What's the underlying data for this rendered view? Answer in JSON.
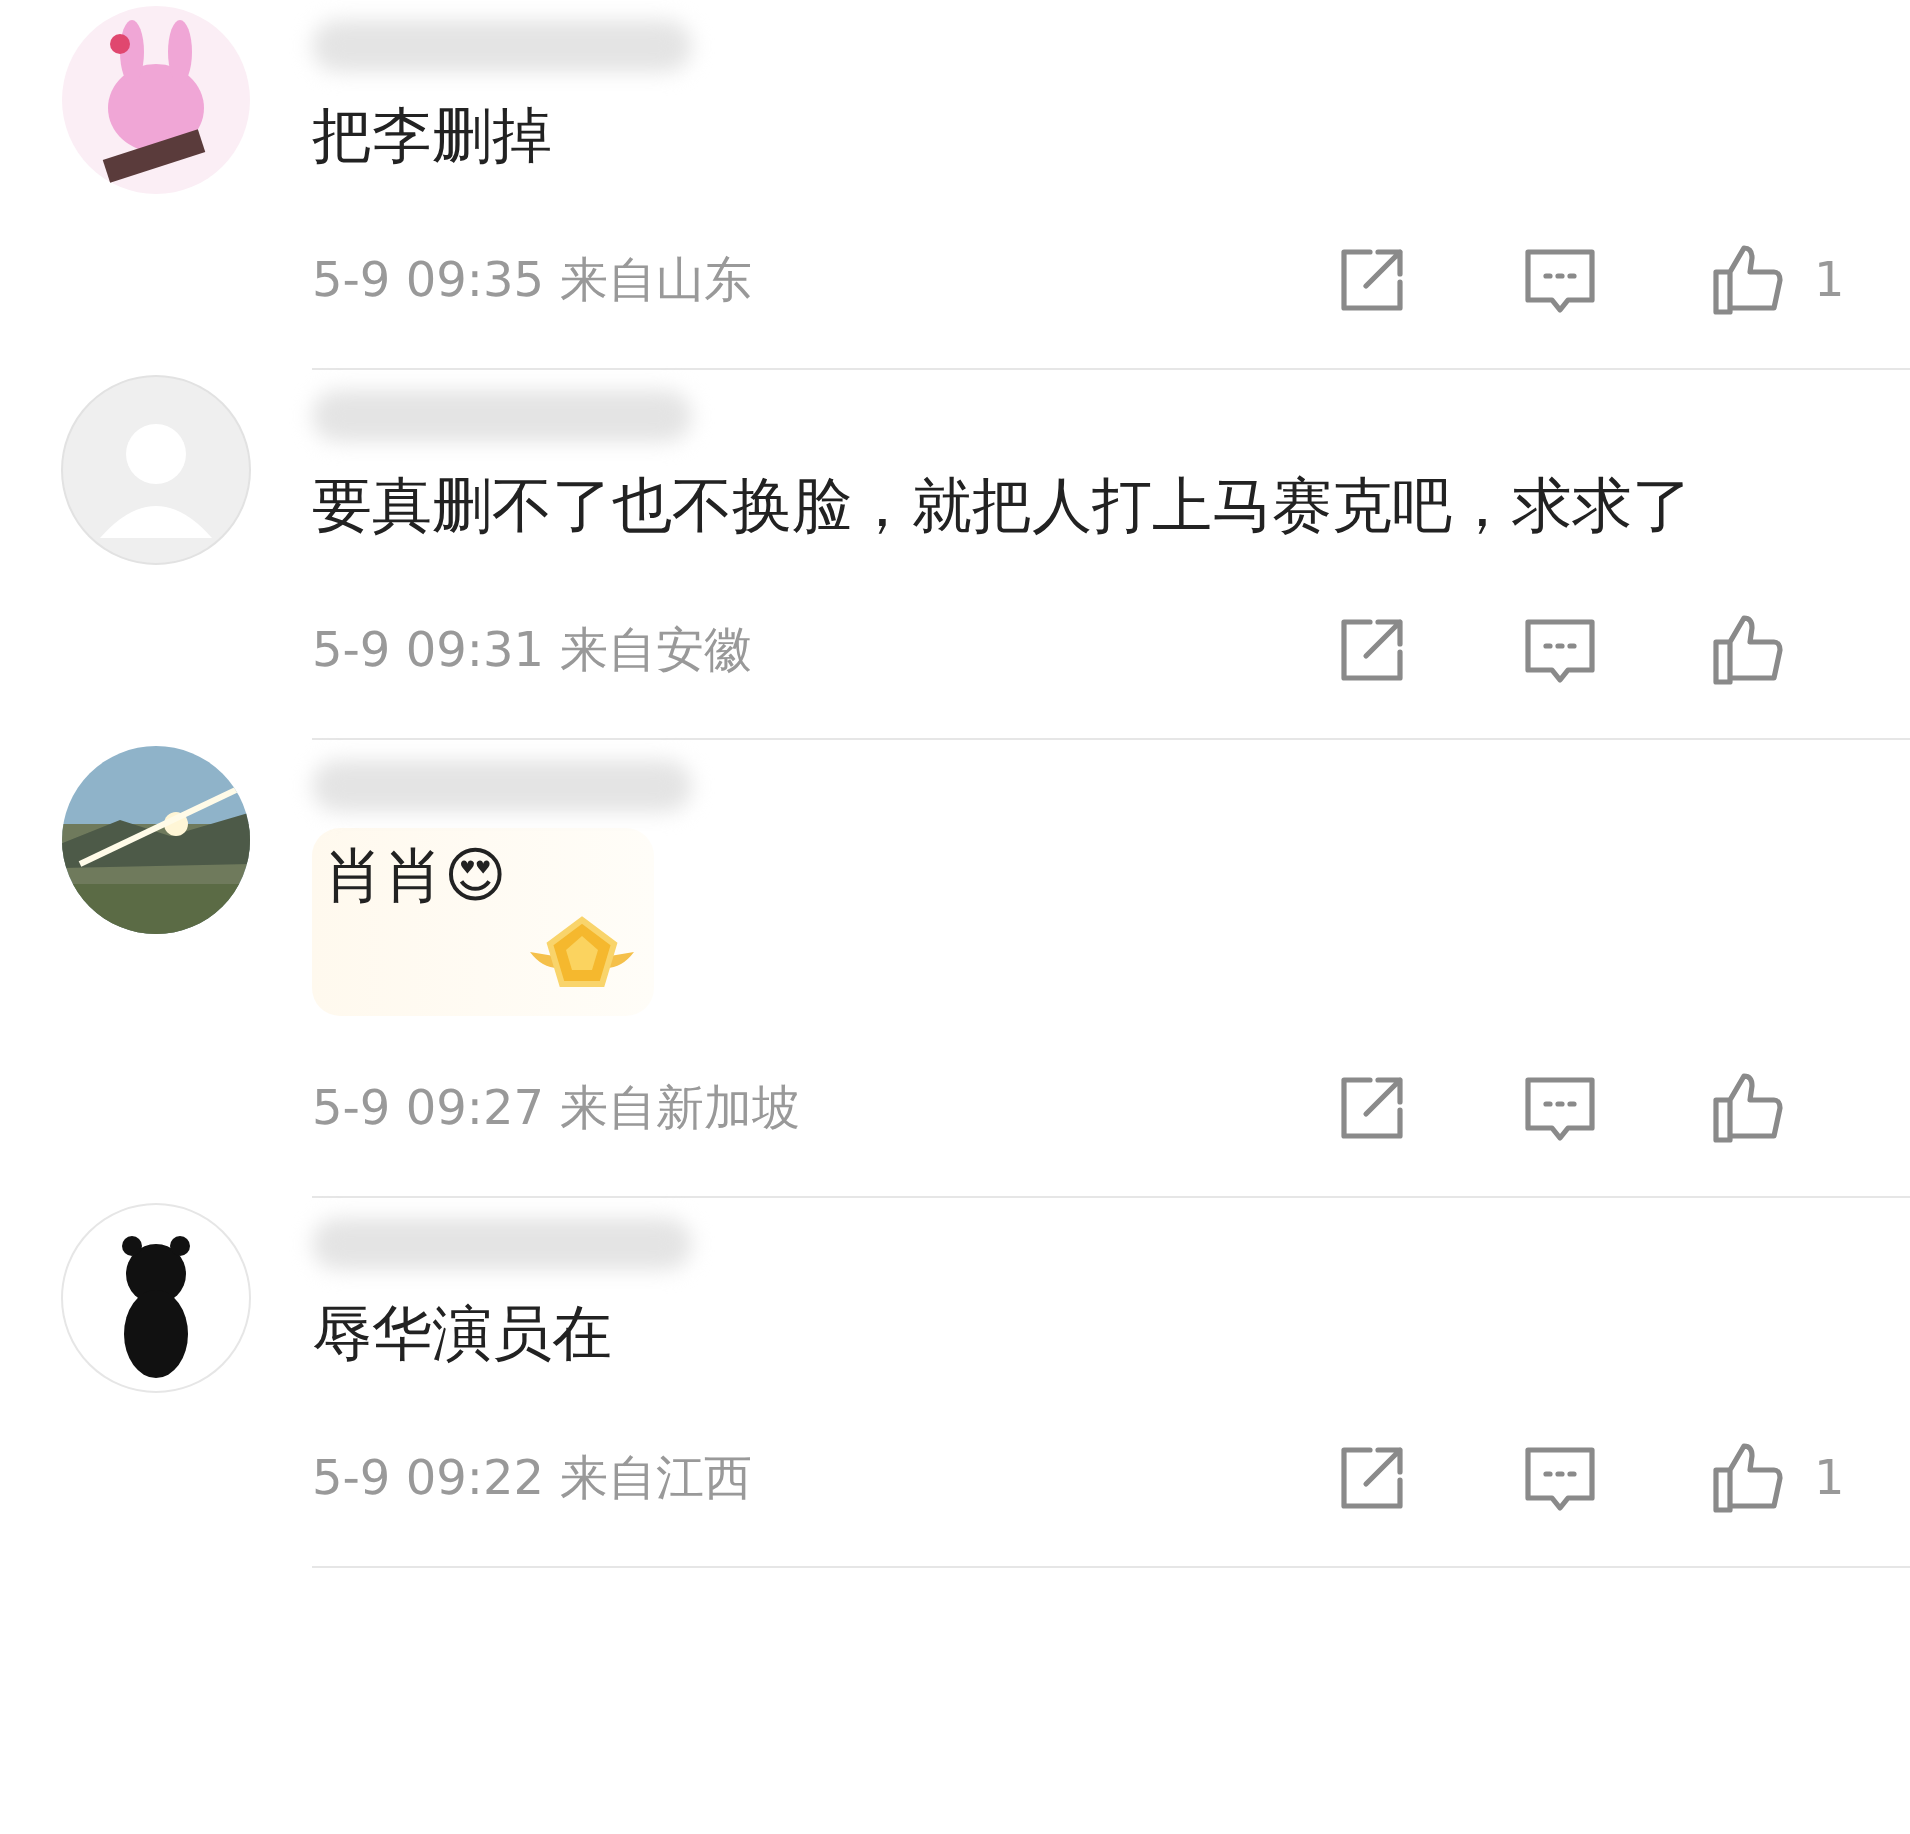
{
  "comments": [
    {
      "text": "把李删掉",
      "time": "5-9 09:35",
      "location": "来自山东",
      "likes": "1",
      "decorated": false
    },
    {
      "text": "要真删不了也不换脸，就把人打上马赛克吧，求求了",
      "time": "5-9 09:31",
      "location": "来自安徽",
      "decorated": false
    },
    {
      "text": "肖肖😍",
      "time": "5-9 09:27",
      "location": "来自新加坡",
      "decorated": true
    },
    {
      "text": "辱华演员在",
      "time": "5-9 09:22",
      "location": "来自江西",
      "likes": "1",
      "decorated": false
    }
  ]
}
